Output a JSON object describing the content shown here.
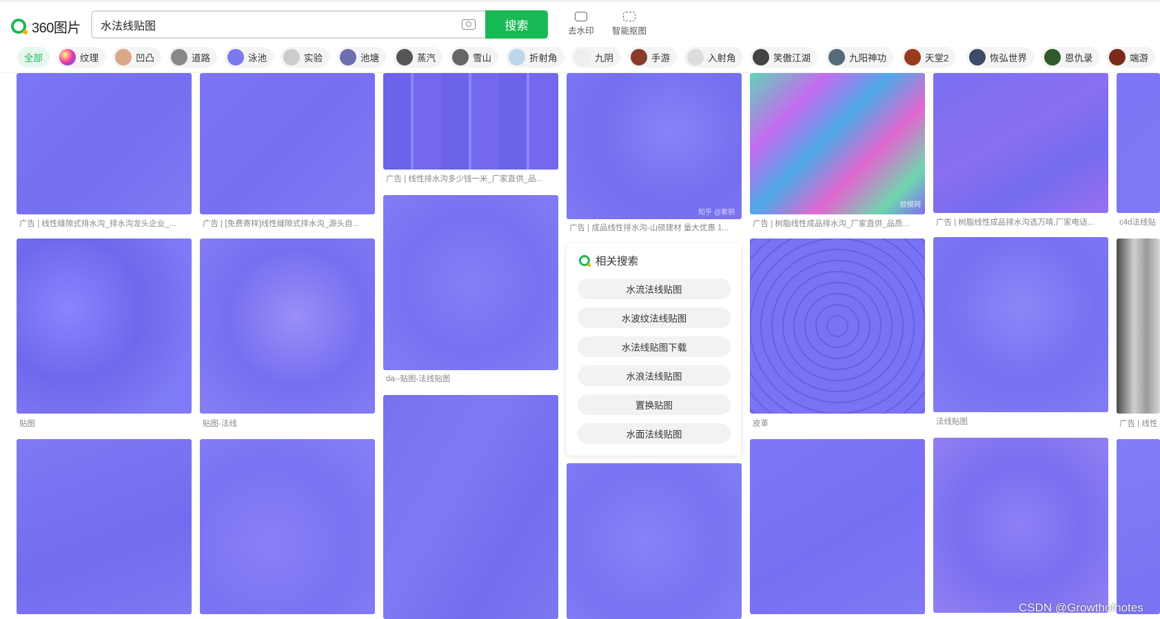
{
  "brand": {
    "logo_text": "360图片"
  },
  "search": {
    "value": "水法线贴图",
    "button_label": "搜索"
  },
  "tools": [
    {
      "label": "去水印"
    },
    {
      "label": "智能抠图"
    }
  ],
  "tags": [
    {
      "label": "全部",
      "active": true
    },
    {
      "label": "纹理"
    },
    {
      "label": "凹凸"
    },
    {
      "label": "道路"
    },
    {
      "label": "泳池"
    },
    {
      "label": "实验"
    },
    {
      "label": "池塘"
    },
    {
      "label": "蒸汽"
    },
    {
      "label": "雪山"
    },
    {
      "label": "折射角"
    },
    {
      "label": "九阴"
    },
    {
      "label": "手游"
    },
    {
      "label": "入射角"
    },
    {
      "label": "笑傲江湖"
    },
    {
      "label": "九阳神功"
    },
    {
      "label": "天堂2"
    },
    {
      "label": "恢弘世界"
    },
    {
      "label": "恩仇录"
    },
    {
      "label": "端游"
    }
  ],
  "results": [
    {
      "caption": "广告 | 线性缝隙式排水沟_排水沟龙头企业_..."
    },
    {
      "caption": "广告 | [免费寄样]线性缝隙式排水沟_源头自..."
    },
    {
      "caption": "广告 | 线性排水沟多少钱一米_厂家直供_品..."
    },
    {
      "caption": "广告 | 成品线性排水沟-山硕建材 量大优惠 1..."
    },
    {
      "caption": "广告 | 树脂线性成品排水沟_厂家直供_品质..."
    },
    {
      "caption": "广告 | 树脂线性成品排水沟选万晴,厂家电话..."
    },
    {
      "caption": "c4d法线贴"
    },
    {
      "caption": "贴图"
    },
    {
      "caption": "贴图-法线"
    },
    {
      "caption": "da--贴图-法线贴图"
    },
    {
      "caption": "皮革"
    },
    {
      "caption": "法线贴图"
    },
    {
      "caption": "广告 | 线性"
    }
  ],
  "image_overlays": {
    "zhihu": "知乎 @紫铜",
    "oumo": "欧模网"
  },
  "related": {
    "title": "相关搜索",
    "items": [
      "水流法线贴图",
      "水波纹法线贴图",
      "水法线贴图下载",
      "水浪法线贴图",
      "置换贴图",
      "水面法线贴图"
    ]
  },
  "watermark": "CSDN @Growthofnotes",
  "colors": {
    "accent": "#19b955",
    "normal_map": "#7b74f2"
  }
}
